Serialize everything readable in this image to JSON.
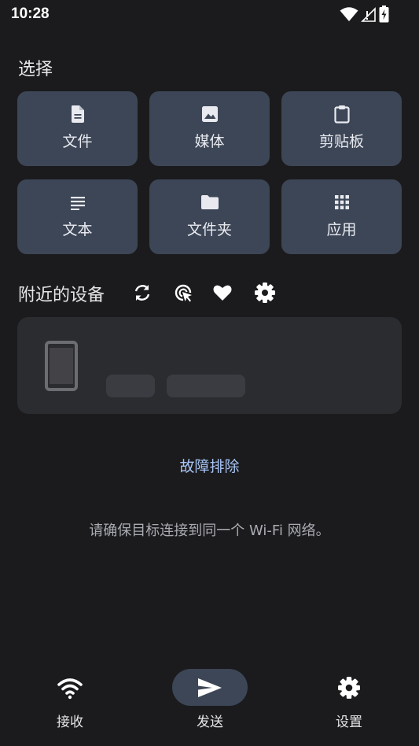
{
  "status_bar": {
    "time": "10:28",
    "icons": [
      "wifi-icon",
      "signal-icon",
      "battery-icon"
    ]
  },
  "select_section": {
    "title": "选择",
    "tiles": [
      {
        "label": "文件",
        "icon": "file-icon"
      },
      {
        "label": "媒体",
        "icon": "image-icon"
      },
      {
        "label": "剪贴板",
        "icon": "clipboard-icon"
      },
      {
        "label": "文本",
        "icon": "text-icon"
      },
      {
        "label": "文件夹",
        "icon": "folder-icon"
      },
      {
        "label": "应用",
        "icon": "apps-grid-icon"
      }
    ]
  },
  "nearby_section": {
    "title": "附近的设备",
    "actions": [
      "refresh-icon",
      "target-scan-icon",
      "favorite-heart-icon",
      "settings-gear-icon"
    ]
  },
  "troubleshoot_link": "故障排除",
  "hint_text": "请确保目标连接到同一个 Wi-Fi 网络。",
  "bottom_nav": {
    "items": [
      {
        "label": "接收",
        "icon": "wifi-receive-icon",
        "active": false
      },
      {
        "label": "发送",
        "icon": "send-icon",
        "active": true
      },
      {
        "label": "设置",
        "icon": "settings-icon",
        "active": false
      }
    ]
  },
  "colors": {
    "background": "#1b1b1d",
    "tile": "#3d4656",
    "card": "#2b2c30",
    "link": "#a7c4f5"
  }
}
